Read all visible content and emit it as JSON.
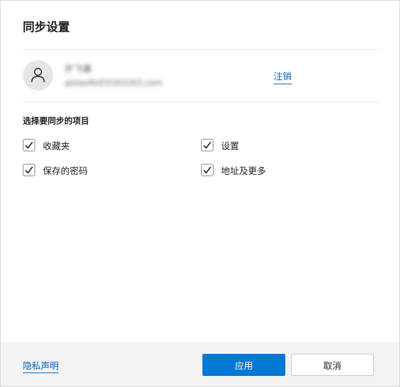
{
  "dialog": {
    "title": "同步设置"
  },
  "account": {
    "name": "许飞谦",
    "email": "qiolaofei03163163.com",
    "sign_out_label": "注销"
  },
  "sync_items": {
    "section_label": "选择要同步的项目",
    "items": [
      {
        "label": "收藏夹",
        "checked": true
      },
      {
        "label": "设置",
        "checked": true
      },
      {
        "label": "保存的密码",
        "checked": true
      },
      {
        "label": "地址及更多",
        "checked": true
      }
    ]
  },
  "footer": {
    "privacy_label": "隐私声明",
    "apply_label": "应用",
    "cancel_label": "取消"
  },
  "colors": {
    "accent": "#0078d4",
    "link": "#0067c0",
    "footer_bg": "#f3f3f3"
  },
  "icons": {
    "avatar": "person-icon",
    "check": "checkmark-icon"
  }
}
